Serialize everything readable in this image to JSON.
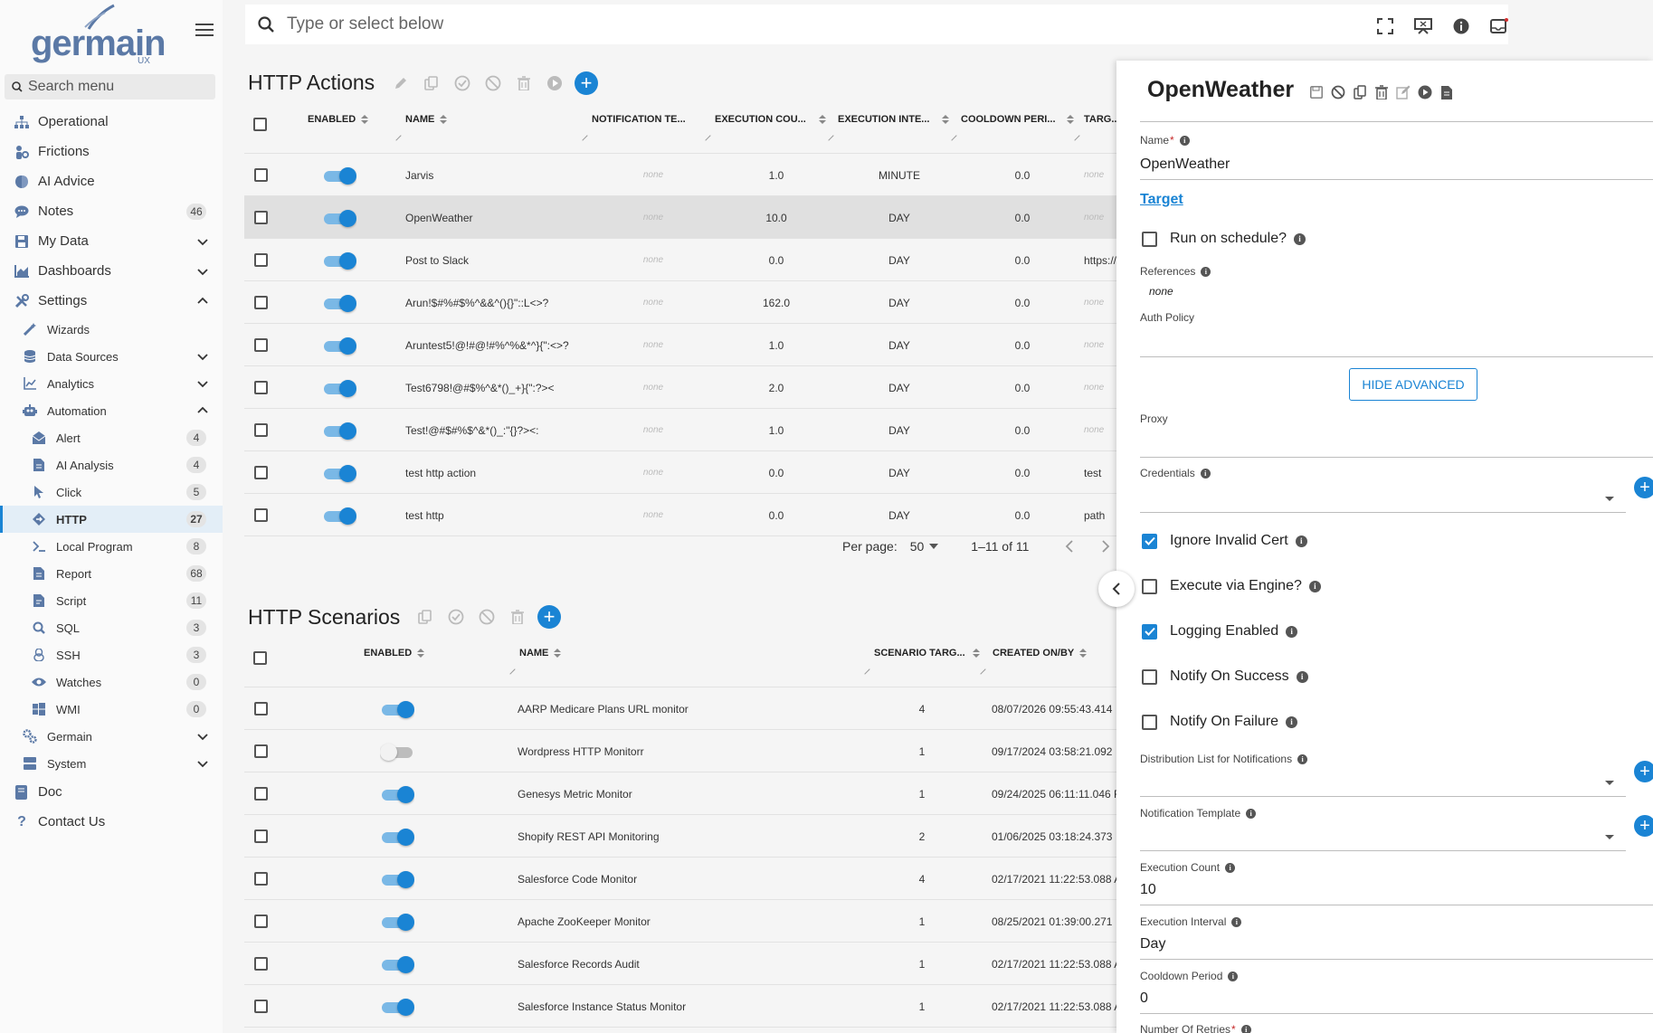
{
  "brand": {
    "logo_text": "germain",
    "logo_sub": "UX"
  },
  "sidebar": {
    "search_placeholder": "Search menu",
    "items": [
      {
        "label": "Operational"
      },
      {
        "label": "Frictions"
      },
      {
        "label": "AI Advice"
      },
      {
        "label": "Notes",
        "badge": "46"
      },
      {
        "label": "My Data"
      },
      {
        "label": "Dashboards"
      },
      {
        "label": "Settings"
      },
      {
        "label": "Wizards"
      },
      {
        "label": "Data Sources"
      },
      {
        "label": "Analytics"
      },
      {
        "label": "Automation"
      },
      {
        "label": "Alert",
        "badge": "4"
      },
      {
        "label": "AI Analysis",
        "badge": "4"
      },
      {
        "label": "Click",
        "badge": "5"
      },
      {
        "label": "HTTP",
        "badge": "27"
      },
      {
        "label": "Local Program",
        "badge": "8"
      },
      {
        "label": "Report",
        "badge": "68"
      },
      {
        "label": "Script",
        "badge": "11"
      },
      {
        "label": "SQL",
        "badge": "3"
      },
      {
        "label": "SSH",
        "badge": "3"
      },
      {
        "label": "Watches",
        "badge": "0"
      },
      {
        "label": "WMI",
        "badge": "0"
      },
      {
        "label": "Germain"
      },
      {
        "label": "System"
      },
      {
        "label": "Doc"
      },
      {
        "label": "Contact Us"
      }
    ]
  },
  "topbar": {
    "search_placeholder": "Type or select below"
  },
  "actions": {
    "title": "HTTP Actions",
    "columns": [
      "ENABLED",
      "NAME",
      "NOTIFICATION TE...",
      "EXECUTION COU...",
      "EXECUTION INTE...",
      "COOLDOWN PERI...",
      "TARG..."
    ],
    "rows": [
      {
        "name": "Jarvis",
        "notif": "none",
        "count": "1.0",
        "interval": "MINUTE",
        "cooldown": "0.0",
        "target": "none",
        "target_none": true
      },
      {
        "name": "OpenWeather",
        "notif": "none",
        "count": "10.0",
        "interval": "DAY",
        "cooldown": "0.0",
        "target": "none",
        "target_none": true
      },
      {
        "name": "Post to Slack",
        "notif": "none",
        "count": "0.0",
        "interval": "DAY",
        "cooldown": "0.0",
        "target": "https://",
        "target_none": false
      },
      {
        "name": "Arun!$#%#$%^&&^(){}\"::L<>?",
        "notif": "none",
        "count": "162.0",
        "interval": "DAY",
        "cooldown": "0.0",
        "target": "none",
        "target_none": true
      },
      {
        "name": "Aruntest5!@!#@!#%^%&*^}{\":<>?",
        "notif": "none",
        "count": "1.0",
        "interval": "DAY",
        "cooldown": "0.0",
        "target": "none",
        "target_none": true
      },
      {
        "name": "Test6798!@#$%^&*()_+}{\":?><",
        "notif": "none",
        "count": "2.0",
        "interval": "DAY",
        "cooldown": "0.0",
        "target": "none",
        "target_none": true
      },
      {
        "name": "Test!@#$#%$^&*()_:\"{}?><:",
        "notif": "none",
        "count": "1.0",
        "interval": "DAY",
        "cooldown": "0.0",
        "target": "none",
        "target_none": true
      },
      {
        "name": "test http action",
        "notif": "none",
        "count": "0.0",
        "interval": "DAY",
        "cooldown": "0.0",
        "target": "test",
        "target_none": false
      },
      {
        "name": "test http",
        "notif": "none",
        "count": "0.0",
        "interval": "DAY",
        "cooldown": "0.0",
        "target": "path",
        "target_none": false
      }
    ],
    "pager": {
      "per_page_label": "Per page:",
      "per_page": "50",
      "range": "1–11 of 11"
    }
  },
  "scenarios": {
    "title": "HTTP Scenarios",
    "columns": [
      "ENABLED",
      "NAME",
      "SCENARIO TARG...",
      "CREATED ON/BY"
    ],
    "rows": [
      {
        "name": "AARP Medicare Plans URL monitor",
        "targets": "4",
        "created": "08/07/2026 09:55:43.414",
        "enabled": true
      },
      {
        "name": "Wordpress HTTP Monitorr",
        "targets": "1",
        "created": "09/17/2024 03:58:21.092",
        "enabled": false
      },
      {
        "name": "Genesys Metric Monitor",
        "targets": "1",
        "created": "09/24/2025 06:11:11.046 F",
        "enabled": true
      },
      {
        "name": "Shopify REST API Monitoring",
        "targets": "2",
        "created": "01/06/2025 03:18:24.373",
        "enabled": true
      },
      {
        "name": "Salesforce Code Monitor",
        "targets": "4",
        "created": "02/17/2021 11:22:53.088 A",
        "enabled": true
      },
      {
        "name": "Apache ZooKeeper Monitor",
        "targets": "1",
        "created": "08/25/2021 01:39:00.271",
        "enabled": true
      },
      {
        "name": "Salesforce Records Audit",
        "targets": "1",
        "created": "02/17/2021 11:22:53.088 A",
        "enabled": true
      },
      {
        "name": "Salesforce Instance Status Monitor",
        "targets": "1",
        "created": "02/17/2021 11:22:53.088 A",
        "enabled": true
      }
    ]
  },
  "panel": {
    "title": "OpenWeather",
    "name_label": "Name",
    "name_value": "OpenWeather",
    "target_link": "Target",
    "run_on_schedule": "Run on schedule?",
    "references_label": "References",
    "references_value": "none",
    "auth_policy_label": "Auth Policy",
    "hide_advanced": "HIDE ADVANCED",
    "proxy_label": "Proxy",
    "credentials_label": "Credentials",
    "ignore_invalid_cert": "Ignore Invalid Cert",
    "execute_via_engine": "Execute via Engine?",
    "logging_enabled": "Logging Enabled",
    "notify_on_success": "Notify On Success",
    "notify_on_failure": "Notify On Failure",
    "distribution_list_label": "Distribution List for Notifications",
    "notification_template_label": "Notification Template",
    "execution_count_label": "Execution Count",
    "execution_count_value": "10",
    "execution_interval_label": "Execution Interval",
    "execution_interval_value": "Day",
    "cooldown_period_label": "Cooldown Period",
    "cooldown_period_value": "0",
    "number_of_retries_label": "Number Of Retries"
  },
  "colors": {
    "accent": "#1a84d4",
    "active_bg": "#e3eef7"
  }
}
